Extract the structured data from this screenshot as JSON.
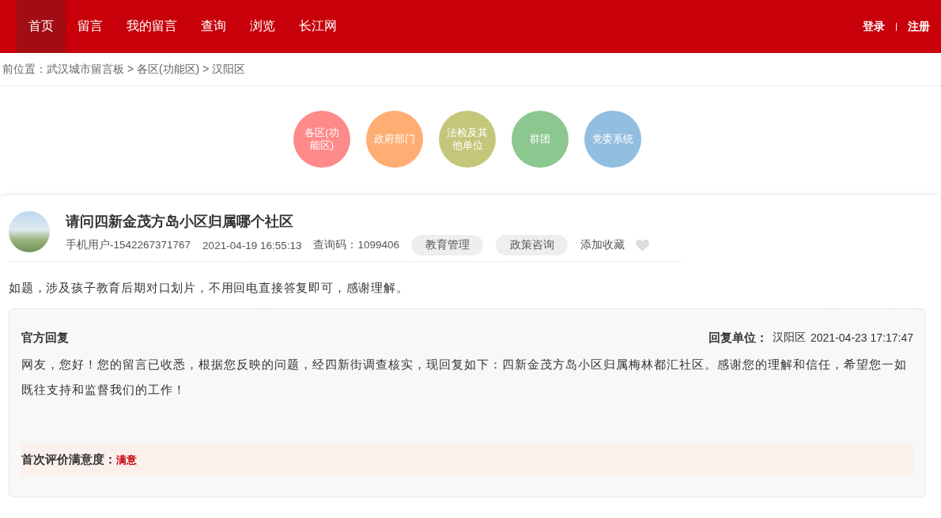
{
  "nav": {
    "items": [
      {
        "label": "首页",
        "selected": true
      },
      {
        "label": "留言",
        "selected": false
      },
      {
        "label": "我的留言",
        "selected": false
      },
      {
        "label": "查询",
        "selected": false
      },
      {
        "label": "浏览",
        "selected": false
      },
      {
        "label": "长江网",
        "selected": false
      }
    ],
    "auth": [
      "登录",
      "注册"
    ]
  },
  "breadcrumb": "前位置：武汉城市留言板 > 各区(功能区) > 汉阳区",
  "categories": [
    {
      "label": "各区(功能区)",
      "color": "#ff8a8a"
    },
    {
      "label": "政府部门",
      "color": "#ffae73"
    },
    {
      "label": "法检及其他单位",
      "color": "#c4c77a"
    },
    {
      "label": "群团",
      "color": "#8cc78f"
    },
    {
      "label": "党委系统",
      "color": "#92bee0"
    }
  ],
  "post": {
    "title": "请问四新金茂方岛小区归属哪个社区",
    "author": "手机用户-1542267371767",
    "time": "2021-04-19 16:55:13",
    "query_code": "查询码：1099406",
    "tags": [
      "教育管理",
      "政策咨询"
    ],
    "favorite_label": "添加收藏",
    "favorited": false,
    "body": "如题，涉及孩子教育后期对口划片，不用回电直接答复即可，感谢理解。"
  },
  "reply": {
    "title": "官方回复",
    "unit_label": "回复单位：",
    "unit": "汉阳区",
    "time": "2021-04-23 17:17:47",
    "text": "网友，您好！您的留言已收悉，根据您反映的问题，经四新街调查核实，现回复如下：四新金茂方岛小区归属梅林都汇社区。感谢您的理解和信任，希望您一如既往支持和监督我们的工作！",
    "rating_label": "首次评价满意度：",
    "rating": "满意"
  }
}
